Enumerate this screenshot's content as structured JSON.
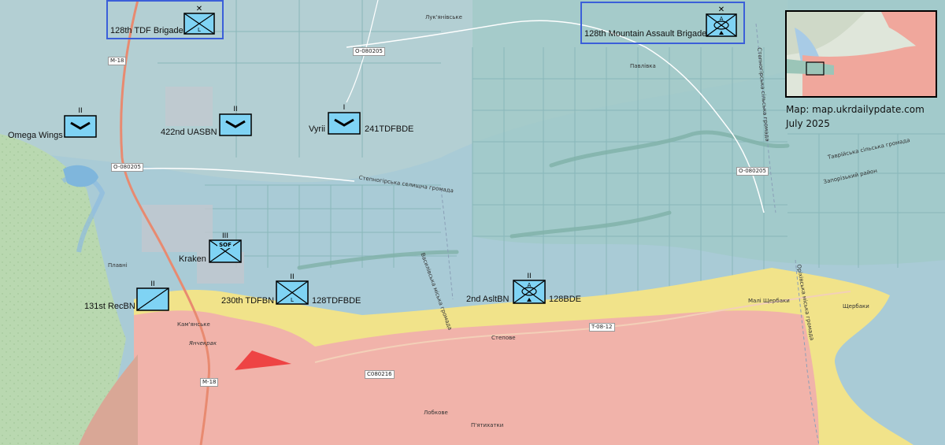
{
  "colors": {
    "ukraine_area": "#a9cbd6",
    "ukraine_area_north": "#b3cfd3",
    "russian_area": "#f1b3aa",
    "contested_area": "#f1e38a",
    "field_lines": "#86b5b8",
    "unit_fill": "#7fd3f4",
    "unit_box_border": "#3b5fd9",
    "frontline_arrow": "#ee4444"
  },
  "units": [
    {
      "id": "128tdf-brigade",
      "label": "128th TDF Brigade",
      "echelon": "X",
      "type": "light-infantry",
      "modifier": "L"
    },
    {
      "id": "128th-mountain-assault-brigade",
      "label": "128th Mountain Assault Brigade",
      "echelon": "X",
      "type": "air-assault",
      "modifier": "A"
    },
    {
      "id": "omega-wings",
      "label": "Omega Wings",
      "echelon": "II",
      "type": "uas"
    },
    {
      "id": "422nd-uasbn",
      "label": "422nd UASBN",
      "echelon": "II",
      "type": "uas"
    },
    {
      "id": "vyrii",
      "label": "Vyrii",
      "label2": "241TDFBDE",
      "echelon": "I",
      "type": "uas"
    },
    {
      "id": "kraken",
      "label": "Kraken",
      "echelon": "III",
      "type": "sof",
      "modifier": "SOF"
    },
    {
      "id": "131st-recbn",
      "label": "131st RecBN",
      "echelon": "II",
      "type": "recon"
    },
    {
      "id": "230th-tdfbn",
      "label": "230th TDFBN",
      "label2": "128TDFBDE",
      "echelon": "II",
      "type": "light-infantry",
      "modifier": "L"
    },
    {
      "id": "2nd-asltbn",
      "label": "2nd AsltBN",
      "label2": "128BDE",
      "echelon": "II",
      "type": "air-assault",
      "modifier": "A"
    }
  ],
  "credit": {
    "line1": "Map: map.ukrdailypdate.com",
    "line2": "July 2025"
  },
  "places": {
    "lukianivske": "Лук'янівське",
    "pavlivka": "Павлівка",
    "plavni": "Плавні",
    "kamianske": "Кам'янське",
    "stepove": "Степове",
    "mali_shcherbaky": "Малі Щербаки",
    "shcherbaky": "Щербаки",
    "lobkove": "Лобкове",
    "piatykhatky": "П'ятихатки",
    "yanchekrak": "Янчекрак",
    "stepnohirsk_community": "Степногірська селищна громада",
    "vasylivska_community": "Василівська міська громада",
    "stepnohirsk_community_2": "Степногірська сільська громада",
    "orikhivska_community": "Оріхівська міська громада",
    "tavriiska_community": "Таврійська сільська громада",
    "zaporizkyi_raion": "Запорізький район"
  },
  "roads": {
    "m18_north": "M-18",
    "m18_south": "M-18",
    "o080205_a": "O-080205",
    "o080205_b": "O-080205",
    "o080205_c": "O-080205",
    "t0812": "T-08-12",
    "c080216": "C080216"
  }
}
